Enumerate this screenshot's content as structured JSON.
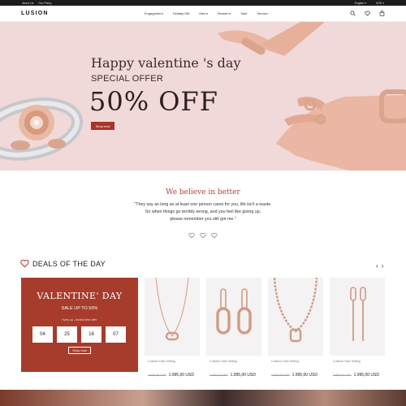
{
  "topbar": {
    "links": [
      "About Us",
      "Our Policy"
    ],
    "language": "English",
    "currency": "USD"
  },
  "header": {
    "logo": "LUSION",
    "nav": [
      "Engagement",
      "Holiday Gift",
      "Men's",
      "Women's",
      "Sale",
      "Service"
    ]
  },
  "hero": {
    "title": "Happy valentine 's day",
    "subtitle": "SPECIAL OFFER",
    "discount": "50% OFF",
    "button": "Shop now"
  },
  "believe": {
    "title": "We believe in better",
    "quote_lines": [
      "\"They say as long as at least one person cares for you, life isn't a waste.",
      "So when things go terribly wrong, and you feel like giving up,",
      "please remember you still got me.\""
    ]
  },
  "deals": {
    "title": "DEALS OF THE DAY",
    "arrow_prev": "‹",
    "arrow_next": "›",
    "promo": {
      "title": "VALENTINE' DAY",
      "sale": "SALE UP TO 50%",
      "hurry": "Hurry up - limited time offer",
      "countdown": [
        "04",
        "25",
        "16",
        "07"
      ],
      "button": "Shop now"
    },
    "products": [
      {
        "name": "Cushion Halo Setting",
        "old_price": "2.995,00 USD",
        "price": "1.995,00 USD"
      },
      {
        "name": "Cushion Halo Setting",
        "old_price": "2.995,00 USD",
        "price": "1.995,00 USD"
      },
      {
        "name": "Cushion Halo Setting",
        "old_price": "2.995,00 USD",
        "price": "1.995,00 USD"
      },
      {
        "name": "Cushion Halo Setting",
        "old_price": "2.995,00 USD",
        "price": "1.995,00 USD"
      }
    ]
  },
  "colors": {
    "accent": "#a8352c",
    "hero_bg": "#f1d9d9",
    "topbar": "#1c1c1c",
    "rose_gold": "#d9a58e"
  },
  "icons": [
    "search-icon",
    "heart-icon",
    "bag-icon",
    "chevron-down-icon",
    "heart-outline-icon"
  ]
}
